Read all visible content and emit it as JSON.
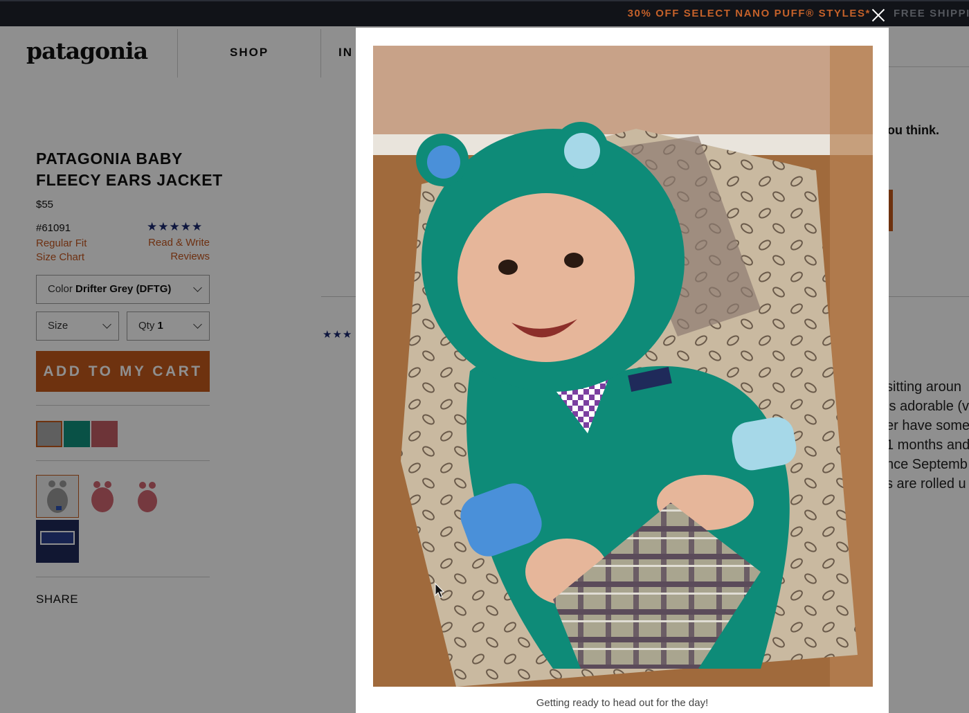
{
  "promo": {
    "text": "30% OFF SELECT NANO PUFF® STYLES*",
    "text2": "FREE SHIPPIN"
  },
  "header": {
    "logo": "patagonia",
    "nav": [
      "SHOP",
      "IN"
    ]
  },
  "product": {
    "title": "PATAGONIA BABY FLEECY EARS JACKET",
    "price": "$55",
    "sku": "#61091",
    "fit_link": "Regular Fit",
    "size_chart_link": "Size Chart",
    "rating": 5,
    "stars": "★★★★★",
    "reviews_link_1": "Read & Write",
    "reviews_link_2": "Reviews",
    "color": {
      "label": "Color",
      "value": "Drifter Grey (DFTG)"
    },
    "size": {
      "label": "Size"
    },
    "qty": {
      "label": "Qty",
      "value": "1"
    },
    "add_to_cart": "ADD TO MY CART",
    "swatch_colors": [
      "#a9a9a9",
      "#11907e",
      "#c35d64"
    ],
    "share": "SHARE"
  },
  "background": {
    "mid_stars": "★★★",
    "right_heading": "ou think.",
    "review_lines": [
      "sitting aroun",
      "is adorable (v",
      "er have some",
      "1 months and",
      "nce Septemb",
      "s are rolled u"
    ]
  },
  "modal": {
    "caption": "Getting ready to head out for the day!",
    "close_icon": "close-icon"
  },
  "colors": {
    "accent": "#c45a1c",
    "promo_bg": "#111318",
    "link": "#c4561f",
    "star": "#1b2a70"
  }
}
